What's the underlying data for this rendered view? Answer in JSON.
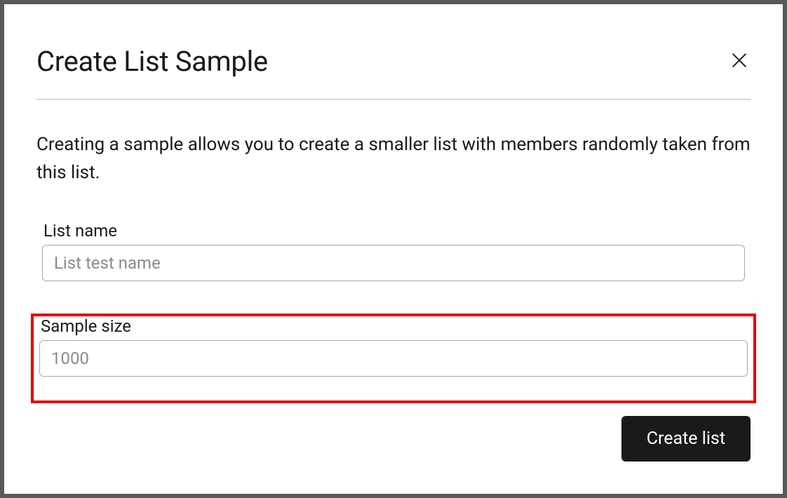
{
  "dialog": {
    "title": "Create List Sample",
    "description": "Creating a sample allows you to create a smaller list with members randomly taken from this list.",
    "fields": {
      "list_name": {
        "label": "List name",
        "placeholder": "List test name",
        "value": ""
      },
      "sample_size": {
        "label": "Sample size",
        "placeholder": "1000",
        "value": ""
      }
    },
    "actions": {
      "create_label": "Create list"
    }
  }
}
